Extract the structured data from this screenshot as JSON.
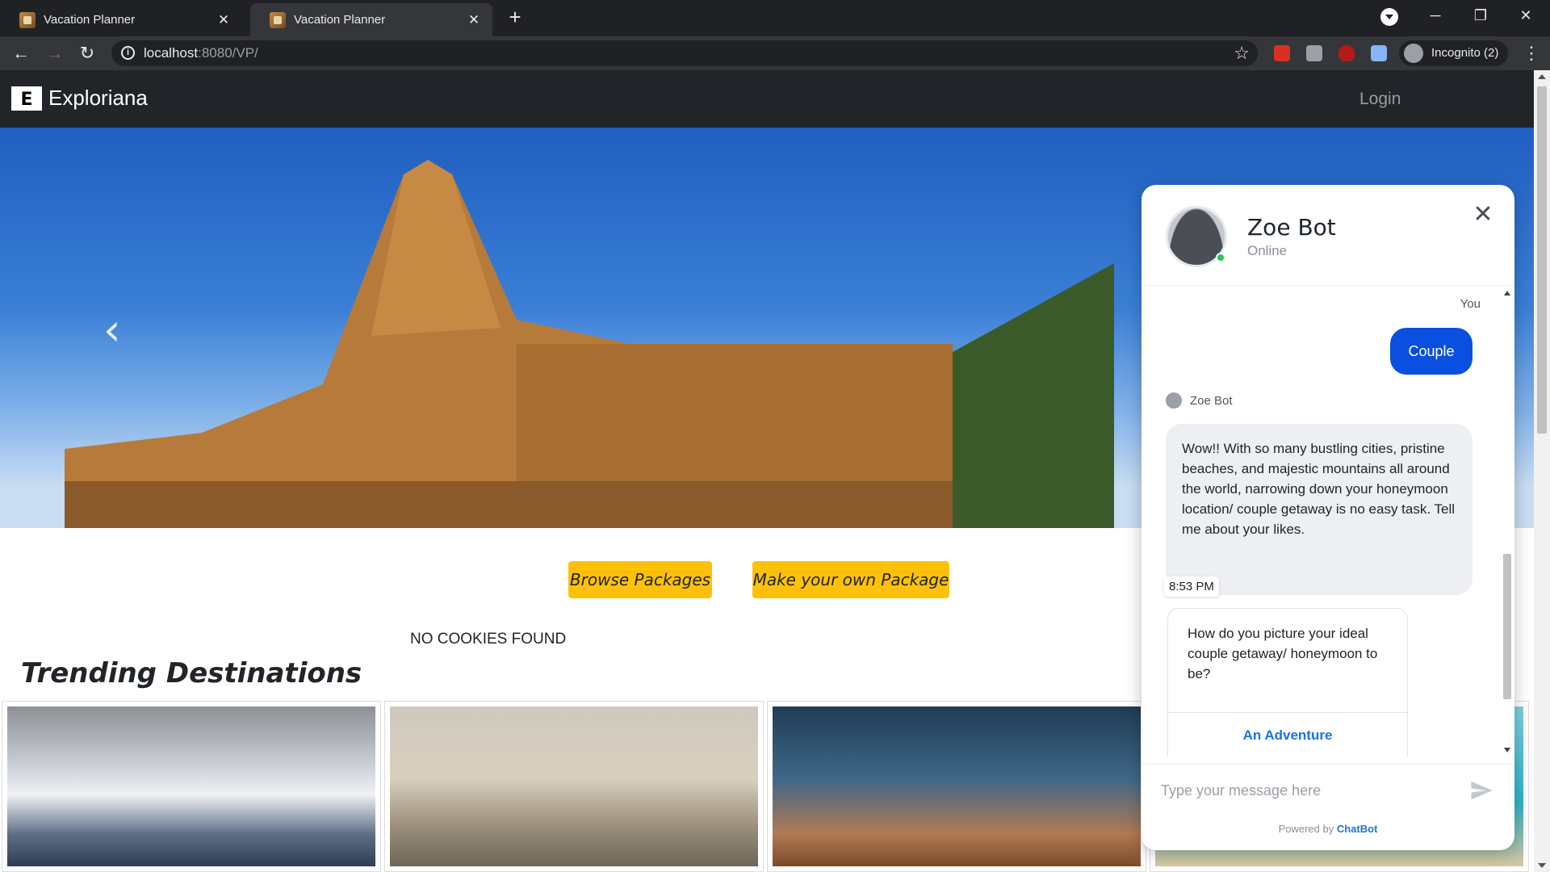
{
  "browser": {
    "tabs": [
      {
        "title": "Vacation Planner",
        "active": false
      },
      {
        "title": "Vacation Planner",
        "active": true
      }
    ],
    "url_host": "localhost",
    "url_rest": ":8080/VP/",
    "incognito_label": "Incognito (2)",
    "extensions": [
      "adblock-icon",
      "camera-icon",
      "ublock-icon",
      "puzzle-icon"
    ]
  },
  "site": {
    "brand_letter": "E",
    "brand_name": "Exploriana",
    "login": "Login",
    "hero_prev": "‹",
    "browse_packages": "Browse Packages",
    "make_package": "Make your own Package",
    "cookies_notice": "NO COOKIES FOUND",
    "trending_title": "Trending Destinations"
  },
  "chat": {
    "bot_name": "Zoe Bot",
    "status": "Online",
    "you_label": "You",
    "user_message": "Couple",
    "bot_label": "Zoe Bot",
    "bot_message": "Wow!! With so many bustling cities, pristine beaches, and majestic mountains all around the world, narrowing down your honeymoon location/ couple getaway is no easy task. Tell me about your likes.",
    "timestamp": "8:53 PM",
    "question": "How do you picture your ideal couple getaway/ honeymoon to be?",
    "option_1": "An Adventure",
    "input_placeholder": "Type your message here",
    "powered_by": "Powered by",
    "powered_brand": "ChatBot"
  },
  "colors": {
    "accent_yellow": "#ffc107",
    "nav_dark": "#212529",
    "chat_blue": "#0b4fe0",
    "online_green": "#1fcb5a"
  }
}
